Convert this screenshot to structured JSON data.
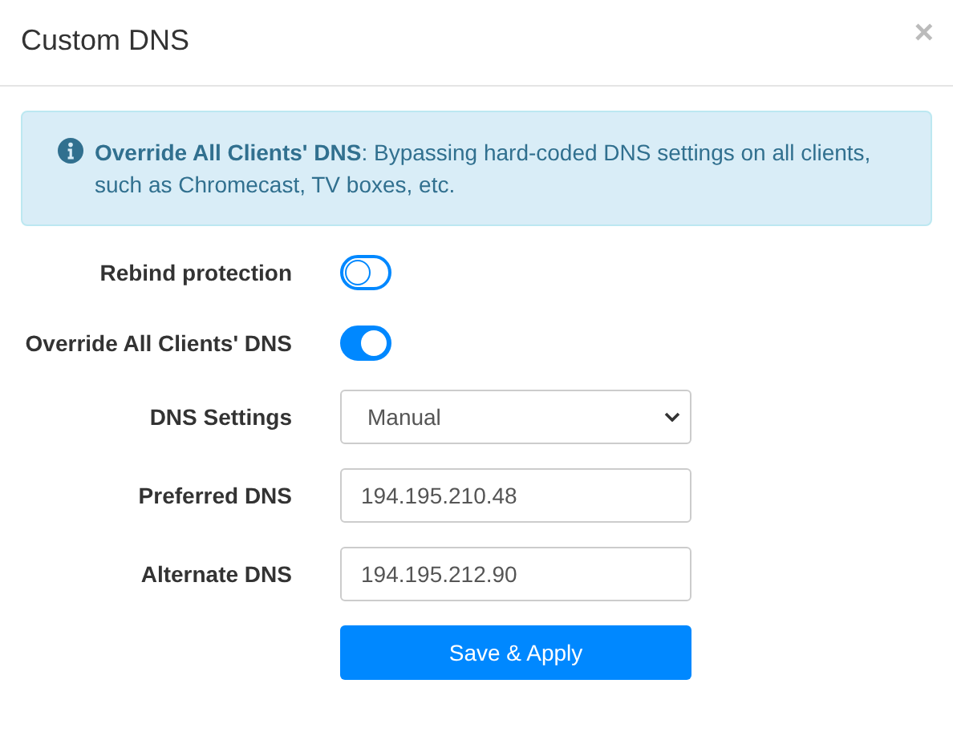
{
  "dialog": {
    "title": "Custom DNS",
    "close": "×"
  },
  "alert": {
    "text": "**Override All Clients' DNS**: Bypassing hard-coded DNS settings on all clients, such as Chromecast, TV boxes, etc."
  },
  "fields": [
    {
      "kind": "toggle",
      "label": "Rebind protection",
      "on": false
    },
    {
      "kind": "toggle",
      "label": "Override All Clients' DNS",
      "on": true
    },
    {
      "kind": "select",
      "label": "DNS Settings",
      "value": "Manual"
    },
    {
      "kind": "input",
      "label": "Preferred DNS",
      "value": "194.195.210.48"
    },
    {
      "kind": "input",
      "label": "Alternate DNS",
      "value": "194.195.212.90"
    }
  ],
  "button": "Save & Apply"
}
